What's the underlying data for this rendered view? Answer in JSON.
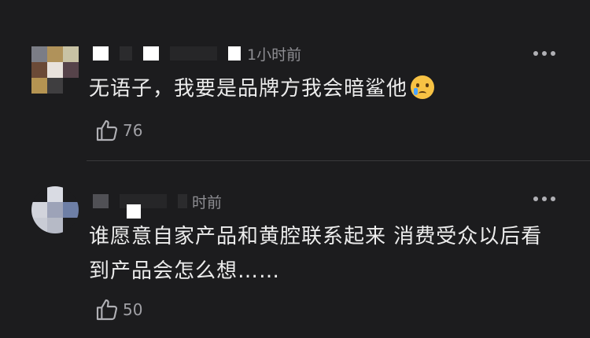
{
  "comments": [
    {
      "time": "1小时前",
      "text": "无语子，我要是品牌方我会暗鲨他",
      "emoji": "crying-face",
      "likes": "76"
    },
    {
      "time": "时前",
      "text": "谁愿意自家产品和黄腔联系起来 消费受众以后看到产品会怎么想……",
      "likes": "50"
    }
  ],
  "colors": {
    "background": "#1c1c1e",
    "text": "#ececec",
    "meta": "#8e8e93"
  }
}
